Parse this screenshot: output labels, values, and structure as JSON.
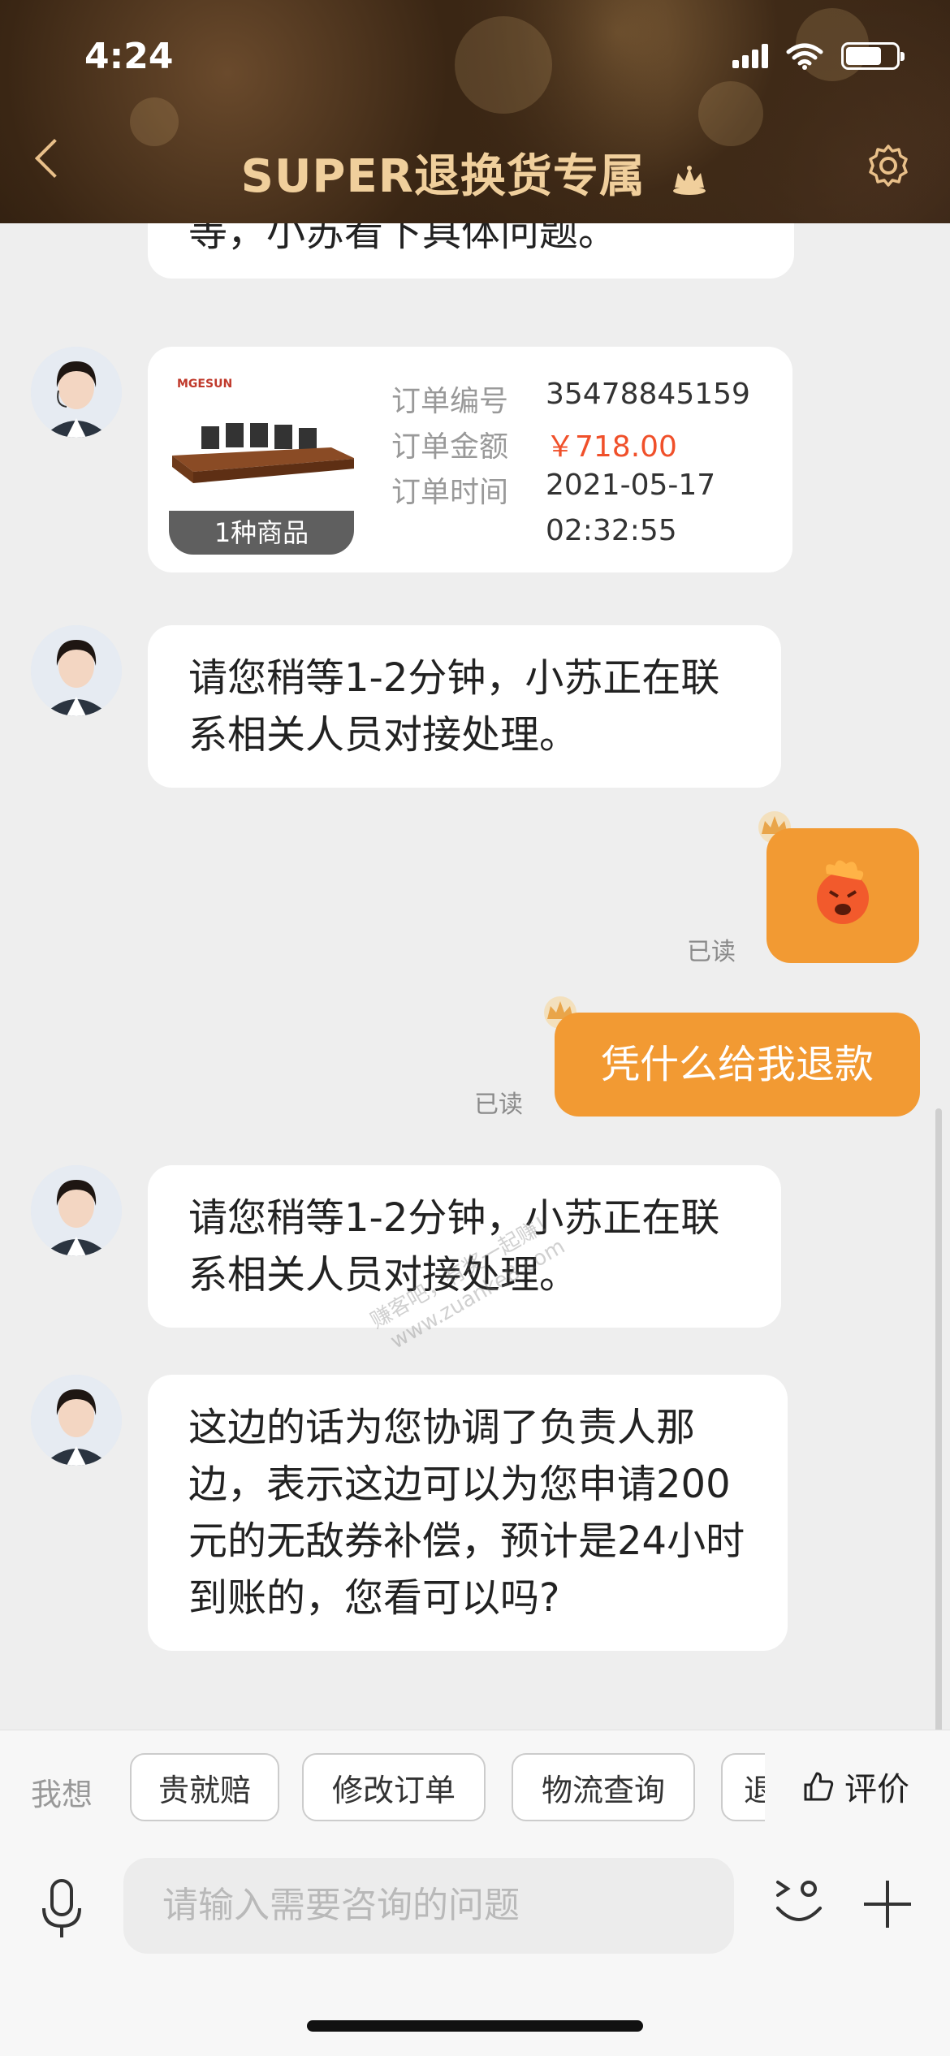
{
  "status_bar": {
    "time": "4:24"
  },
  "header": {
    "title": "SUPER退换货专属",
    "icons": [
      "back-icon",
      "crown-icon",
      "settings-gear-icon"
    ]
  },
  "messages": [
    {
      "side": "left",
      "text": "等，小苏看下具体问题。"
    },
    {
      "side": "left",
      "type": "order_card",
      "thumbnail_brand": "MGESUN",
      "item_count": "1种商品",
      "rows": [
        {
          "label": "订单编号",
          "value": "35478845159"
        },
        {
          "label": "订单金额",
          "value": "￥718.00"
        },
        {
          "label": "订单时间",
          "value": "2021-05-17"
        },
        {
          "label": "",
          "value": "02:32:55"
        }
      ]
    },
    {
      "side": "left",
      "text": "请您稍等1-2分钟，小苏正在联系相关人员对接处理。"
    },
    {
      "side": "right",
      "type": "emoji",
      "read": "已读"
    },
    {
      "side": "right",
      "text": "凭什么给我退款",
      "read": "已读"
    },
    {
      "side": "left",
      "text": "请您稍等1-2分钟，小苏正在联系相关人员对接处理。"
    },
    {
      "side": "left",
      "text": "这边的话为您协调了负责人那边，表示这边可以为您申请200元的无敌券补偿，预计是24小时到账的，您看可以吗?"
    }
  ],
  "watermark": {
    "line1": "赚客吧，有奖一起赚！",
    "line2": "www.zuanke8.com"
  },
  "quick_bar": {
    "label": "我想",
    "chips": [
      "贵就赔",
      "修改订单",
      "物流查询",
      "退"
    ],
    "rate_label": "评价"
  },
  "input_bar": {
    "placeholder": "请输入需要咨询的问题"
  },
  "colors": {
    "accent": "#f29a33",
    "title_gold": "#f0cf9c",
    "price_red": "#f0502a"
  }
}
